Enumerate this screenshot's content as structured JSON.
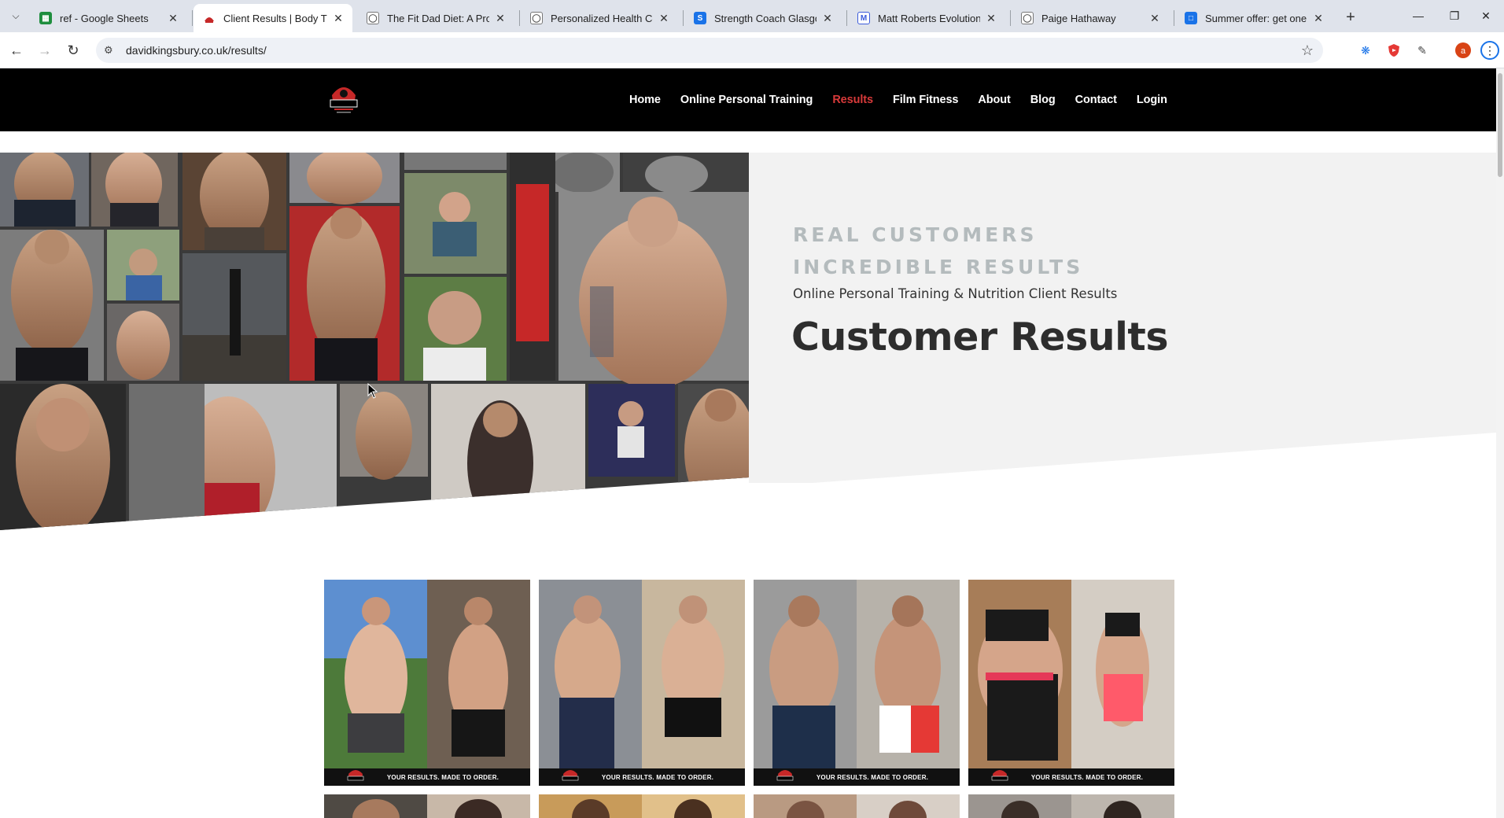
{
  "browser": {
    "tabs": [
      {
        "title": "ref - Google Sheets",
        "favicon": "sheets-icon",
        "color": "#1e8e3e"
      },
      {
        "title": "Client Results | Body Trans",
        "favicon": "site-icon",
        "color": "#c62828",
        "active": true
      },
      {
        "title": "The Fit Dad Diet: A Prove",
        "favicon": "globe-icon",
        "color": "#5f6368"
      },
      {
        "title": "Personalized Health Coac",
        "favicon": "globe-icon",
        "color": "#5f6368"
      },
      {
        "title": "Strength Coach Glasgow",
        "favicon": "s-icon",
        "color": "#1a73e8"
      },
      {
        "title": "Matt Roberts Evolution |",
        "favicon": "m-icon",
        "color": "#3b5bdb"
      },
      {
        "title": "Paige Hathaway",
        "favicon": "globe-icon",
        "color": "#5f6368"
      },
      {
        "title": "Summer offer: get one m",
        "favicon": "chat-icon",
        "color": "#1a73e8"
      }
    ],
    "url": "davidkingsbury.co.uk/results/"
  },
  "site": {
    "logo_text": "KINGSBURY",
    "nav": [
      {
        "label": "Home"
      },
      {
        "label": "Online Personal Training"
      },
      {
        "label": "Results",
        "current": true
      },
      {
        "label": "Film Fitness"
      },
      {
        "label": "About"
      },
      {
        "label": "Blog"
      },
      {
        "label": "Contact"
      },
      {
        "label": "Login"
      }
    ],
    "hero": {
      "kicker_line1": "REAL CUSTOMERS",
      "kicker_line2": "INCREDIBLE RESULTS",
      "subtitle": "Online Personal Training & Nutrition Client Results",
      "title": "Customer Results"
    },
    "results_caption": "YOUR RESULTS. MADE TO ORDER."
  },
  "colors": {
    "header_bg": "#000000",
    "nav_active": "#d83a3a",
    "hero_panel": "#f2f2f2",
    "kicker": "#b4bbbd",
    "title": "#2d2d2d"
  }
}
